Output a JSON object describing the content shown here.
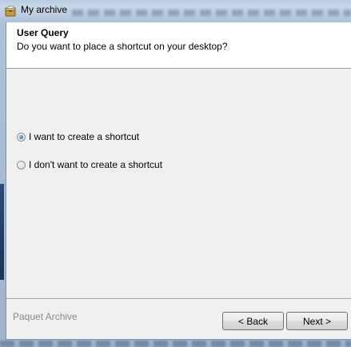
{
  "window": {
    "title": "My archive"
  },
  "header": {
    "title": "User Query",
    "subtitle": "Do you want to place a shortcut on your desktop?"
  },
  "options": [
    {
      "label": "I want to create a shortcut",
      "checked": true
    },
    {
      "label": "I don't want to create a shortcut",
      "checked": false
    }
  ],
  "footer": {
    "brand": "Paquet Archive",
    "back_label": "< Back",
    "next_label": "Next >"
  },
  "icons": {
    "app": "archive-icon"
  }
}
